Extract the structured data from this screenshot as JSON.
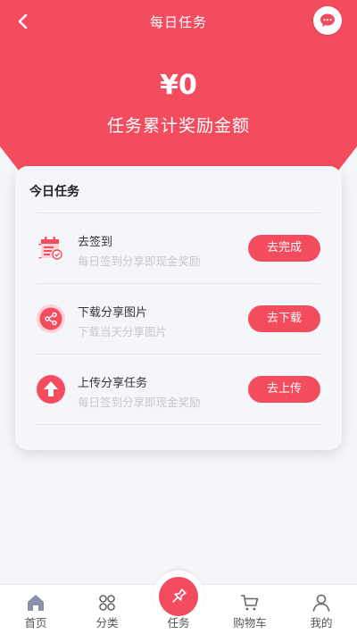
{
  "colors": {
    "primary": "#f44c5f",
    "background": "#f5f6fa"
  },
  "nav": {
    "title": "每日任务",
    "back_icon": "chevron-left-icon",
    "message_icon": "chat-bubble-icon"
  },
  "summary": {
    "amount": "¥0",
    "label": "任务累计奖励金额"
  },
  "card": {
    "title": "今日任务",
    "tasks": [
      {
        "icon": "sign-in-calendar-icon",
        "name": "去签到",
        "desc": "每日签到分享即现金奖励",
        "button": "去完成"
      },
      {
        "icon": "share-icon",
        "name": "下载分享图片",
        "desc": "下载当天分享图片",
        "button": "去下载"
      },
      {
        "icon": "upload-arrow-icon",
        "name": "上传分享任务",
        "desc": "每日签到分享即现金奖励",
        "button": "去上传"
      }
    ]
  },
  "tabbar": {
    "items": [
      {
        "label": "首页",
        "icon": "home-icon"
      },
      {
        "label": "分类",
        "icon": "category-icon"
      },
      {
        "label": "任务",
        "icon": "pin-icon",
        "active": true
      },
      {
        "label": "购物车",
        "icon": "cart-icon"
      },
      {
        "label": "我的",
        "icon": "user-icon"
      }
    ]
  }
}
